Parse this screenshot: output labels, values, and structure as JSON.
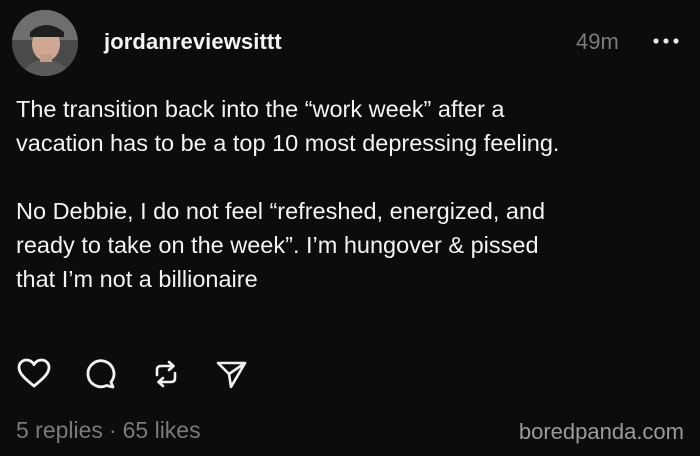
{
  "post": {
    "username": "jordanreviewsittt",
    "timestamp": "49m",
    "more_icon": "more-dots-icon",
    "paragraphs": [
      "The transition back into the “work week” after a\nvacation has to be a top 10 most depressing feeling.",
      "No Debbie, I do not feel “refreshed, energized, and\nready to take on the week”. I’m hungover & pissed\nthat I’m not a billionaire"
    ],
    "actions": [
      {
        "icon": "heart-icon"
      },
      {
        "icon": "comment-icon"
      },
      {
        "icon": "repost-icon"
      },
      {
        "icon": "share-icon"
      }
    ],
    "stats": {
      "replies": "5 replies",
      "separator": "·",
      "likes": "65 likes"
    },
    "watermark": "boredpanda.com"
  }
}
